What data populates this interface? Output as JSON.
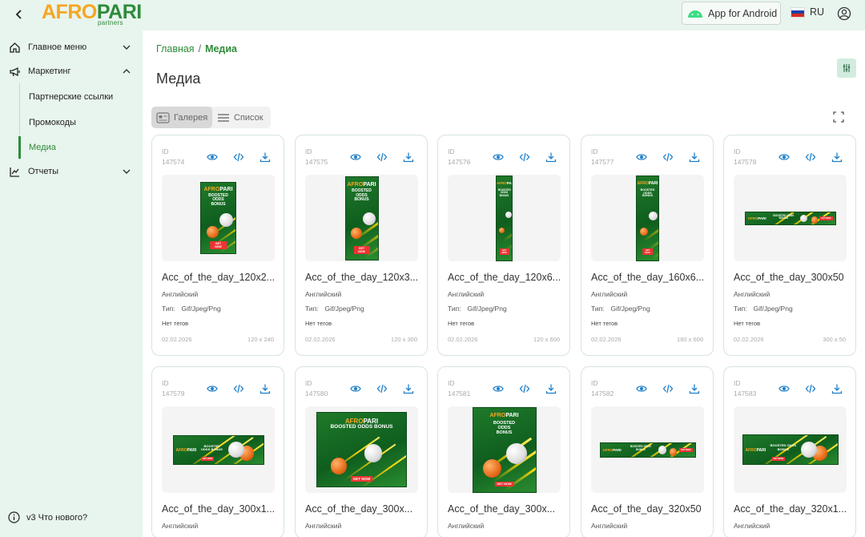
{
  "topbar": {
    "logo_afro": "AFRO",
    "logo_pari": "PARI",
    "logo_sub": "partners",
    "android_label": "App for Android",
    "lang_code": "RU"
  },
  "sidebar": {
    "main_menu": "Главное меню",
    "marketing": "Маркетинг",
    "sub_links": "Партнерские ссылки",
    "sub_promo": "Промокоды",
    "sub_media": "Медиа",
    "reports": "Отчеты",
    "whats_new": "v3 Что нового?"
  },
  "main": {
    "breadcrumb_home": "Главная",
    "breadcrumb_sep": "/",
    "breadcrumb_current": "Медиа",
    "title": "Медиа",
    "view_gallery": "Галерея",
    "view_list": "Список"
  },
  "card_labels": {
    "id": "ID",
    "type_prefix": "Тип:",
    "tags": "Нет тегов"
  },
  "banner_text": {
    "logo_afro": "AFRO",
    "logo_pari": "PARI",
    "headline": "BOOSTED ODDS BONUS",
    "cta": "GET NOW"
  },
  "cards": [
    {
      "id": "147574",
      "name": "Acc_of_the_day_120x2...",
      "language": "Английский",
      "type": "Gif/Jpeg/Png",
      "date": "02.02.2026",
      "size": "120 x 240",
      "banner": "b120x240"
    },
    {
      "id": "147575",
      "name": "Acc_of_the_day_120x3...",
      "language": "Английский",
      "type": "Gif/Jpeg/Png",
      "date": "02.02.2026",
      "size": "120 x 300",
      "banner": "b120x300"
    },
    {
      "id": "147576",
      "name": "Acc_of_the_day_120x6...",
      "language": "Английский",
      "type": "Gif/Jpeg/Png",
      "date": "02.02.2026",
      "size": "120 x 600",
      "banner": "b120x600"
    },
    {
      "id": "147577",
      "name": "Acc_of_the_day_160x6...",
      "language": "Английский",
      "type": "Gif/Jpeg/Png",
      "date": "02.02.2026",
      "size": "160 x 600",
      "banner": "b160x600"
    },
    {
      "id": "147578",
      "name": "Acc_of_the_day_300x50",
      "language": "Английский",
      "type": "Gif/Jpeg/Png",
      "date": "02.02.2026",
      "size": "300 x 50",
      "banner": "b300x50"
    },
    {
      "id": "147579",
      "name": "Acc_of_the_day_300x1...",
      "language": "Английский",
      "banner": "b300x100"
    },
    {
      "id": "147580",
      "name": "Acc_of_the_day_300x...",
      "language": "Английский",
      "banner": "b300x250"
    },
    {
      "id": "147581",
      "name": "Acc_of_the_day_300x...",
      "language": "Английский",
      "banner": "b300x300"
    },
    {
      "id": "147582",
      "name": "Acc_of_the_day_320x50",
      "language": "Английский",
      "banner": "b320x50"
    },
    {
      "id": "147583",
      "name": "Acc_of_the_day_320x1...",
      "language": "Английский",
      "banner": "b320x100"
    }
  ],
  "colors": {
    "accent": "#2e8b3a",
    "sidebar_bg": "#e8f4ee",
    "brand_orange": "#f5a623"
  },
  "icons": {
    "view": "eye-icon",
    "embed": "code-icon",
    "download": "download-icon"
  }
}
